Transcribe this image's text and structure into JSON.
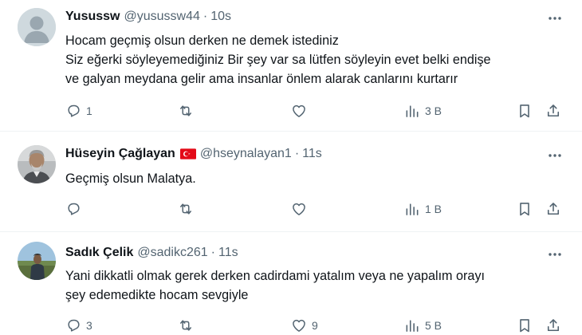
{
  "tweets": [
    {
      "name": "Yusussw",
      "handle": "@yusussw44",
      "separator": "·",
      "time": "10s",
      "lines": [
        "Hocam geçmiş olsun derken ne demek istediniz",
        "Siz eğerki söyleyemediğiniz Bir şey var sa lütfen söyleyin evet belki endişe",
        "ve galyan meydana gelir ama insanlar önlem alarak canlarını kurtarır"
      ],
      "replies": "1",
      "retweets": "",
      "likes": "",
      "views": "3 B"
    },
    {
      "name": "Hüseyin Çağlayan",
      "handle": "@hseynalayan1",
      "separator": "·",
      "time": "11s",
      "lines": [
        "Geçmiş olsun Malatya."
      ],
      "replies": "",
      "retweets": "",
      "likes": "",
      "views": "1 B"
    },
    {
      "name": "Sadık Çelik",
      "handle": "@sadikc261",
      "separator": "·",
      "time": "11s",
      "lines": [
        "Yani dikkatli olmak gerek derken cadirdami yatalım veya ne yapalım orayı",
        "şey edemedikte hocam sevgiyle"
      ],
      "replies": "3",
      "retweets": "",
      "likes": "9",
      "views": "5 B"
    }
  ],
  "icons": {
    "reply": "reply-icon",
    "retweet": "retweet-icon",
    "like": "like-icon",
    "views": "views-icon",
    "bookmark": "bookmark-icon",
    "share": "share-icon",
    "more": "more-icon",
    "flag": "turkey-flag-icon"
  },
  "colors": {
    "text": "#0f1419",
    "secondary": "#536471",
    "divider": "#eff3f4",
    "flag_red": "#e30a17"
  }
}
